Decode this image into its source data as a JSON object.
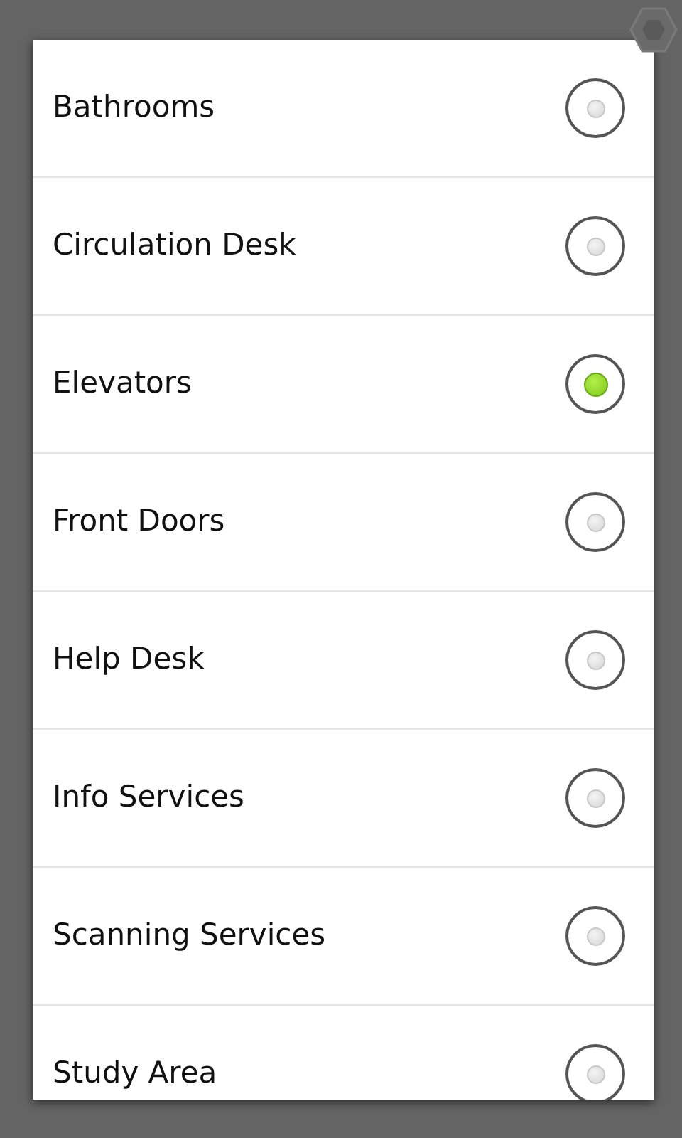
{
  "options": [
    {
      "label": "Bathrooms",
      "selected": false
    },
    {
      "label": "Circulation Desk",
      "selected": false
    },
    {
      "label": "Elevators",
      "selected": true
    },
    {
      "label": "Front Doors",
      "selected": false
    },
    {
      "label": "Help Desk",
      "selected": false
    },
    {
      "label": "Info Services",
      "selected": false
    },
    {
      "label": "Scanning Services",
      "selected": false
    },
    {
      "label": "Study Area",
      "selected": false
    }
  ]
}
